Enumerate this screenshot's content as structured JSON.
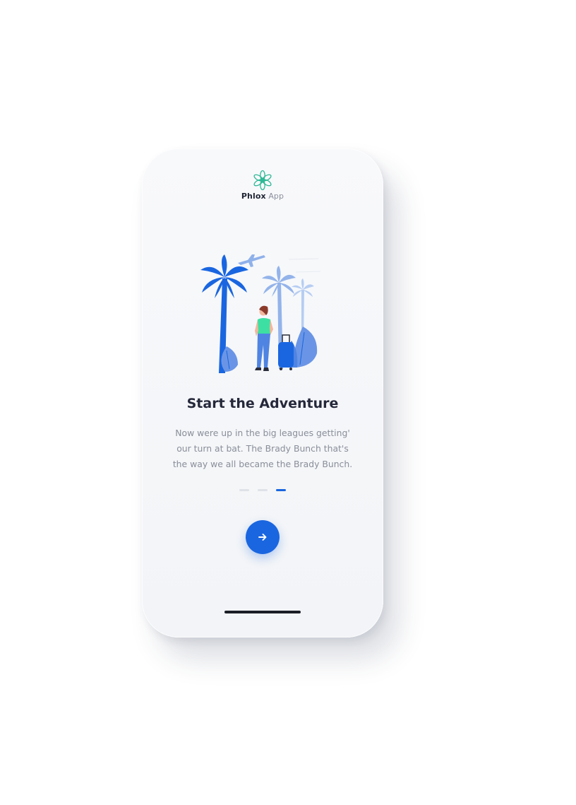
{
  "app": {
    "brand_bold": "Phlox",
    "brand_light": "App"
  },
  "onboarding": {
    "title": "Start the Adventure",
    "description": "Now were up in the big leagues getting' our turn at bat. The Brady Bunch that's the way we all became the Brady Bunch.",
    "step_current": 3,
    "step_total": 3,
    "next_icon": "arrow-right-icon"
  },
  "colors": {
    "accent": "#1a66e0",
    "logo": "#2fb895",
    "title": "#25283a",
    "body_text": "#8a8e99"
  }
}
